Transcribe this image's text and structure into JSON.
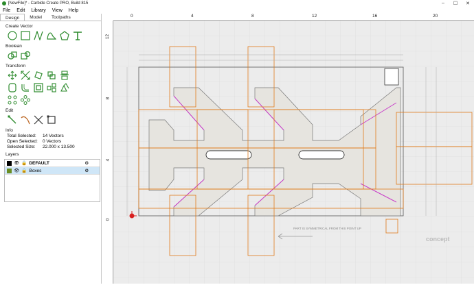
{
  "window": {
    "title": "[NewFile]* - Carbide Create PRO, Build 815",
    "min": "–",
    "max": "☐",
    "close": "✕"
  },
  "menu": [
    "File",
    "Edit",
    "Library",
    "View",
    "Help"
  ],
  "tabs": [
    "Design",
    "Model",
    "Toolpaths"
  ],
  "sections": {
    "create_vector": "Create Vector",
    "boolean": "Boolean",
    "transform": "Transform",
    "edit": "Edit",
    "info": "Info",
    "layers": "Layers"
  },
  "info": {
    "total_selected_label": "Total Selected:",
    "total_selected_value": "14 Vectors",
    "open_selected_label": "Open Selected:",
    "open_selected_value": "0 Vectors",
    "selected_size_label": "Selected Size:",
    "selected_size_value": "22.000 x 13.500"
  },
  "layers": [
    {
      "name": "DEFAULT",
      "color": "#000000",
      "selected": false
    },
    {
      "name": "Boxes",
      "color": "#6b8e23",
      "selected": true
    }
  ],
  "ruler": {
    "x_ticks": [
      "0",
      "4",
      "8",
      "12",
      "16",
      "20"
    ],
    "y_ticks": [
      "12",
      "8",
      "4",
      "0"
    ]
  },
  "notes": {
    "symmetric": "PART IS SYMMETRICAL FROM THIS POINT UP",
    "brand": "concept"
  },
  "colors": {
    "accent_green": "#2e8b2e",
    "toolpath_orange": "#e07b1a",
    "selection_magenta": "#c83cc8",
    "part_fill": "#e6e4df"
  }
}
